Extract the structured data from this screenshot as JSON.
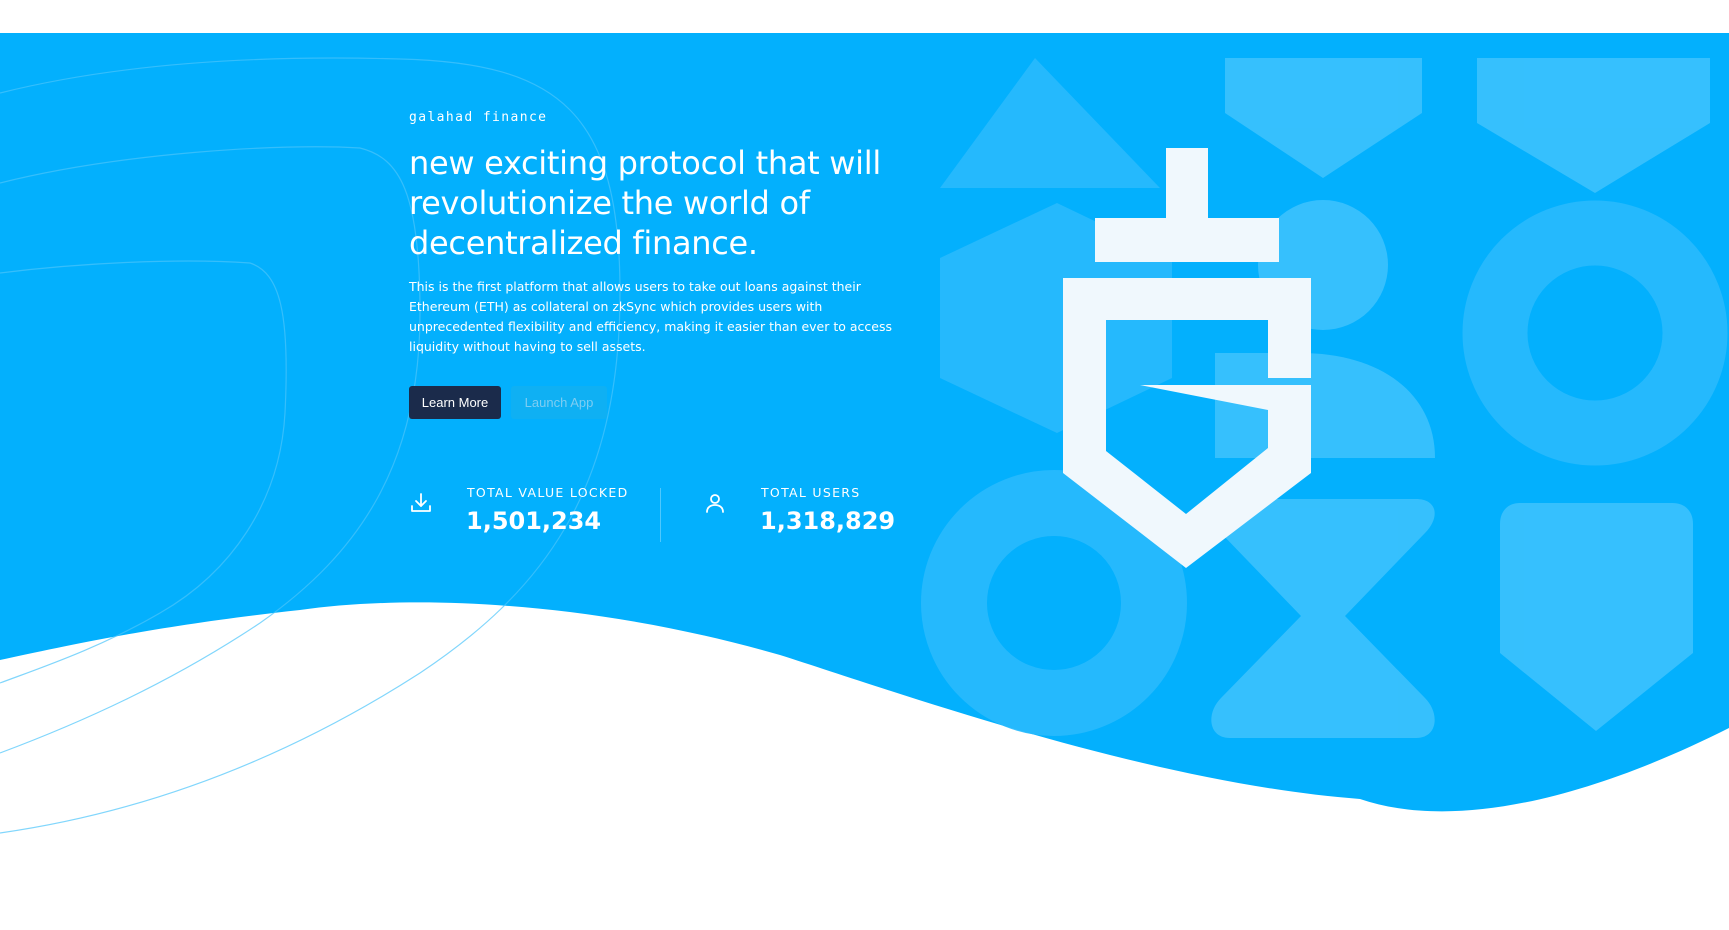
{
  "brand": {
    "eyebrow": "galahad finance"
  },
  "hero": {
    "headline": "new exciting protocol that will revolutionize the world of decentralized finance.",
    "description": "This is the first platform that allows users to take out loans against their Ethereum (ETH) as collateral on zkSync which provides users with unprecedented flexibility and efficiency, making it easier than ever to access liquidity without having to sell assets.",
    "learn_more_label": "Learn More",
    "launch_app_label": "Launch App"
  },
  "stats": [
    {
      "icon": "download-icon",
      "label": "TOTAL VALUE LOCKED",
      "value": "1,501,234"
    },
    {
      "icon": "user-icon",
      "label": "TOTAL USERS",
      "value": "1,318,829"
    }
  ],
  "colors": {
    "hero_background": "#03b0fd",
    "primary_button": "#1b2b4b",
    "logo": "#f0f8fd",
    "text": "#ffffff"
  }
}
